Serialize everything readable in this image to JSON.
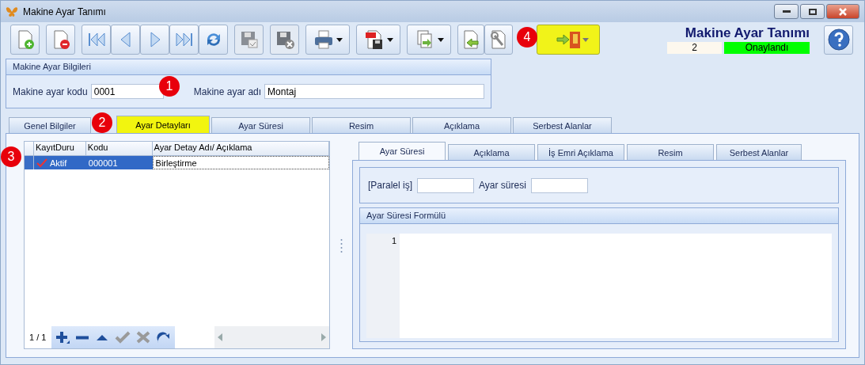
{
  "window": {
    "title": "Makine Ayar Tanımı"
  },
  "toolbar": [
    {
      "kind": "new",
      "disabled": false,
      "dropdown": false
    },
    {
      "kind": "delete",
      "disabled": false,
      "dropdown": false
    },
    {
      "kind": "first",
      "disabled": false,
      "dropdown": false
    },
    {
      "kind": "prev",
      "disabled": false,
      "dropdown": false
    },
    {
      "kind": "next",
      "disabled": false,
      "dropdown": false
    },
    {
      "kind": "last",
      "disabled": false,
      "dropdown": false
    },
    {
      "kind": "refresh",
      "disabled": false,
      "dropdown": false
    },
    {
      "kind": "save",
      "disabled": true,
      "dropdown": false
    },
    {
      "kind": "cancel",
      "disabled": true,
      "dropdown": false
    },
    {
      "kind": "print",
      "disabled": false,
      "dropdown": true
    },
    {
      "kind": "pdf",
      "disabled": false,
      "dropdown": true
    },
    {
      "kind": "export",
      "disabled": false,
      "dropdown": true
    },
    {
      "kind": "import",
      "disabled": false,
      "dropdown": false
    },
    {
      "kind": "tools",
      "disabled": false,
      "dropdown": false
    },
    {
      "kind": "exit",
      "disabled": false,
      "dropdown": true
    }
  ],
  "header": {
    "title": "Makine Ayar Tanımı",
    "number": "2",
    "status": "Onaylandı"
  },
  "info_group": {
    "title": "Makine Ayar Bilgileri",
    "fields": [
      {
        "label": "Makine ayar kodu",
        "value": "0001"
      },
      {
        "label": "Makine ayar adı",
        "value": "Montaj"
      }
    ]
  },
  "tabs": [
    {
      "label": "Genel Bilgiler",
      "selected": false
    },
    {
      "label": "Ayar Detayları",
      "selected": true
    },
    {
      "label": "Ayar Süresi",
      "selected": false
    },
    {
      "label": "Resim",
      "selected": false
    },
    {
      "label": "Açıklama",
      "selected": false
    },
    {
      "label": "Serbest Alanlar",
      "selected": false
    }
  ],
  "grid": {
    "columns": [
      "KayıtDuru",
      "Kodu",
      "Ayar Detay Adı/ Açıklama"
    ],
    "rows": [
      {
        "status": "Aktif",
        "active": true,
        "code": "000001",
        "name": "Birleştirme",
        "selected": true
      }
    ],
    "pager": "1 / 1",
    "nav": [
      {
        "kind": "add",
        "disabled": false
      },
      {
        "kind": "remove",
        "disabled": false
      },
      {
        "kind": "up",
        "disabled": false
      },
      {
        "kind": "confirm",
        "disabled": true
      },
      {
        "kind": "discard",
        "disabled": true
      },
      {
        "kind": "redo",
        "disabled": false
      }
    ]
  },
  "detail_tabs": [
    {
      "label": "Ayar Süresi",
      "selected": true
    },
    {
      "label": "Açıklama",
      "selected": false
    },
    {
      "label": "İş Emri Açıklama",
      "selected": false
    },
    {
      "label": "Resim",
      "selected": false
    },
    {
      "label": "Serbest Alanlar",
      "selected": false
    }
  ],
  "detail_fields": [
    {
      "label": "[Paralel iş]"
    },
    {
      "label": "Ayar süresi"
    }
  ],
  "formula": {
    "title": "Ayar Süresi Formülü",
    "line_numbers": [
      "1"
    ]
  },
  "markers": [
    {
      "label": "1"
    },
    {
      "label": "2"
    },
    {
      "label": "3"
    },
    {
      "label": "4"
    }
  ]
}
